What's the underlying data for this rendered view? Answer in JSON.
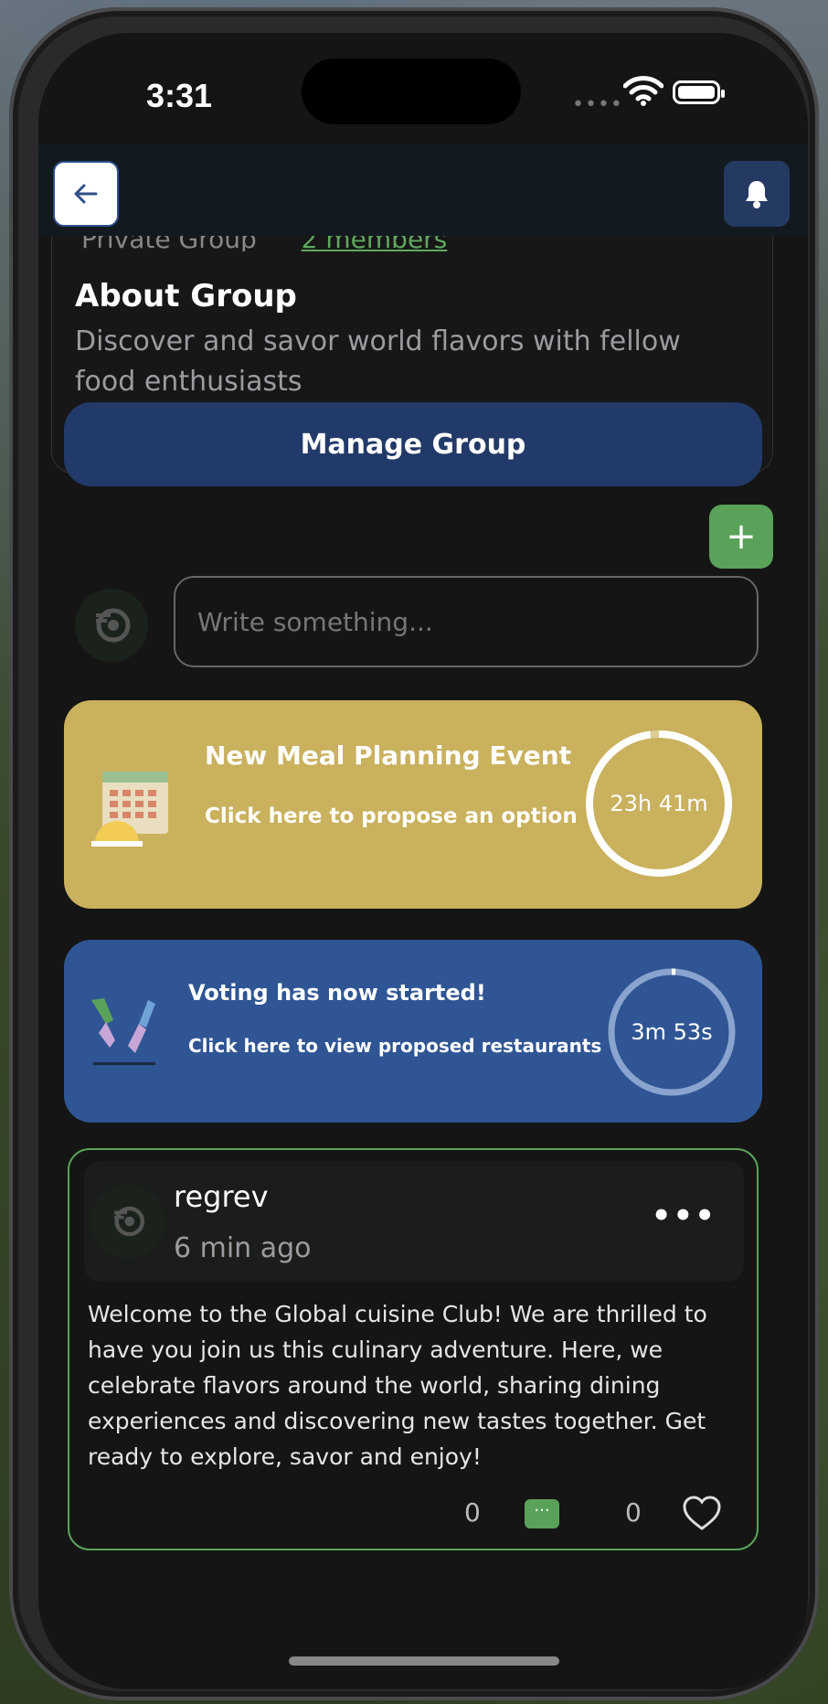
{
  "status_bar": {
    "time": "3:31",
    "signal": "••••"
  },
  "topbar": {
    "back": "back",
    "notifications": "notifications"
  },
  "group": {
    "privacy": "Private Group",
    "members": "2 members",
    "about_title": "About Group",
    "about_desc": "Discover and savor world flavors with fellow food enthusiasts",
    "manage_label": "Manage Group",
    "add_label": "+"
  },
  "composer": {
    "placeholder": "Write something..."
  },
  "event_card": {
    "title": "New Meal Planning Event",
    "subtitle": "Click here to propose an option",
    "timer": "23h 41m",
    "progress": 0.98
  },
  "vote_card": {
    "title": "Voting has now started!",
    "subtitle": "Click here to view proposed restaurants",
    "timer": "3m 53s",
    "progress": 0.01
  },
  "post": {
    "user": "regrev",
    "time": "6 min ago",
    "menu": "•••",
    "body": "Welcome to the Global cuisine Club! We are thrilled to have you join us this culinary adventure. Here, we celebrate flavors around the world, sharing dining experiences and discovering new tastes together. Get ready to explore, savor and enjoy!",
    "comments_count": "0",
    "likes_count": "0",
    "comment_glyph": "···"
  },
  "colors": {
    "event_bg": "#c9b15d",
    "vote_bg": "#2f5594",
    "manage_bg": "#223a69",
    "accent_green": "#5aa25a"
  }
}
